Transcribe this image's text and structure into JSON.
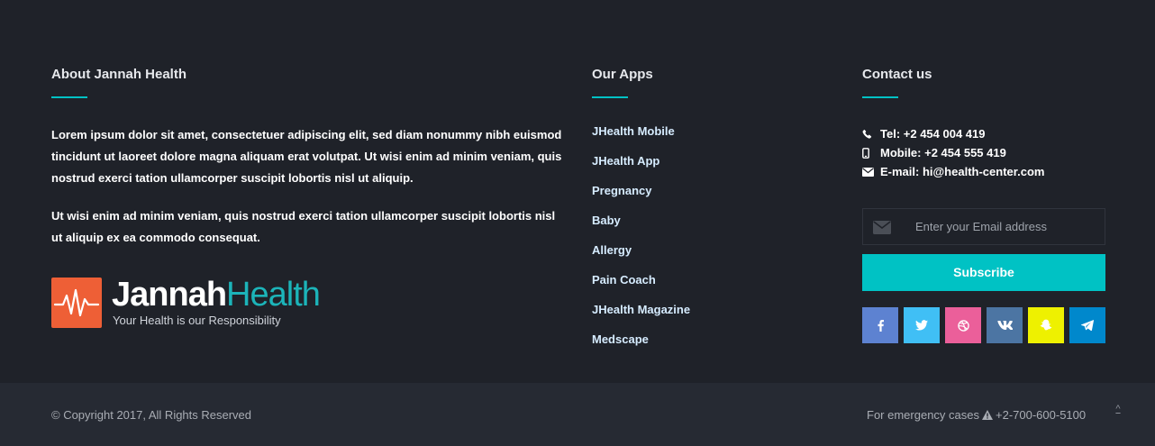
{
  "about": {
    "title": "About Jannah Health",
    "paragraph1": "Lorem ipsum dolor sit amet, consectetuer adipiscing elit, sed diam nonummy nibh euismod tincidunt ut laoreet dolore magna aliquam erat volutpat. Ut wisi enim ad minim veniam, quis nostrud exerci tation ullamcorper suscipit lobortis nisl ut aliquip.",
    "paragraph2": "Ut wisi enim ad minim veniam, quis nostrud exerci tation ullamcorper suscipit lobortis nisl ut aliquip ex ea commodo consequat.",
    "logo": {
      "name_bold": "Jannah",
      "name_light": "Health",
      "tagline": "Your Health is our Responsibility",
      "box_color": "#ee5f36",
      "accent_color": "#1cb4b9"
    }
  },
  "apps": {
    "title": "Our Apps",
    "items": [
      "JHealth Mobile",
      "JHealth App",
      "Pregnancy",
      "Baby",
      "Allergy",
      "Pain Coach",
      "JHealth Magazine",
      "Medscape"
    ]
  },
  "contact": {
    "title": "Contact us",
    "tel": "Tel: +2 454 004 419",
    "mobile": "Mobile: +2 454 555 419",
    "email": "E-mail: hi@health-center.com",
    "email_placeholder": "Enter your Email address",
    "subscribe_label": "Subscribe",
    "social": [
      {
        "name": "facebook-icon",
        "glyph": "f",
        "color": "#5d82d1"
      },
      {
        "name": "twitter-icon",
        "glyph": "",
        "color": "#40bff5"
      },
      {
        "name": "dribbble-icon",
        "glyph": "",
        "color": "#eb5f9a"
      },
      {
        "name": "vk-icon",
        "glyph": "vk",
        "color": "#4c75a3"
      },
      {
        "name": "snapchat-icon",
        "glyph": "",
        "color": "#eef100"
      },
      {
        "name": "telegram-icon",
        "glyph": "",
        "color": "#0088cc"
      }
    ]
  },
  "bottom": {
    "copyright": "© Copyright 2017, All Rights Reserved",
    "emergency_label": "For emergency cases",
    "emergency_phone": "+2-700-600-5100",
    "to_top_glyph": "^"
  },
  "colors": {
    "accent": "#00c2c4",
    "background": "#1f2229",
    "bottom_background": "#262a33"
  }
}
